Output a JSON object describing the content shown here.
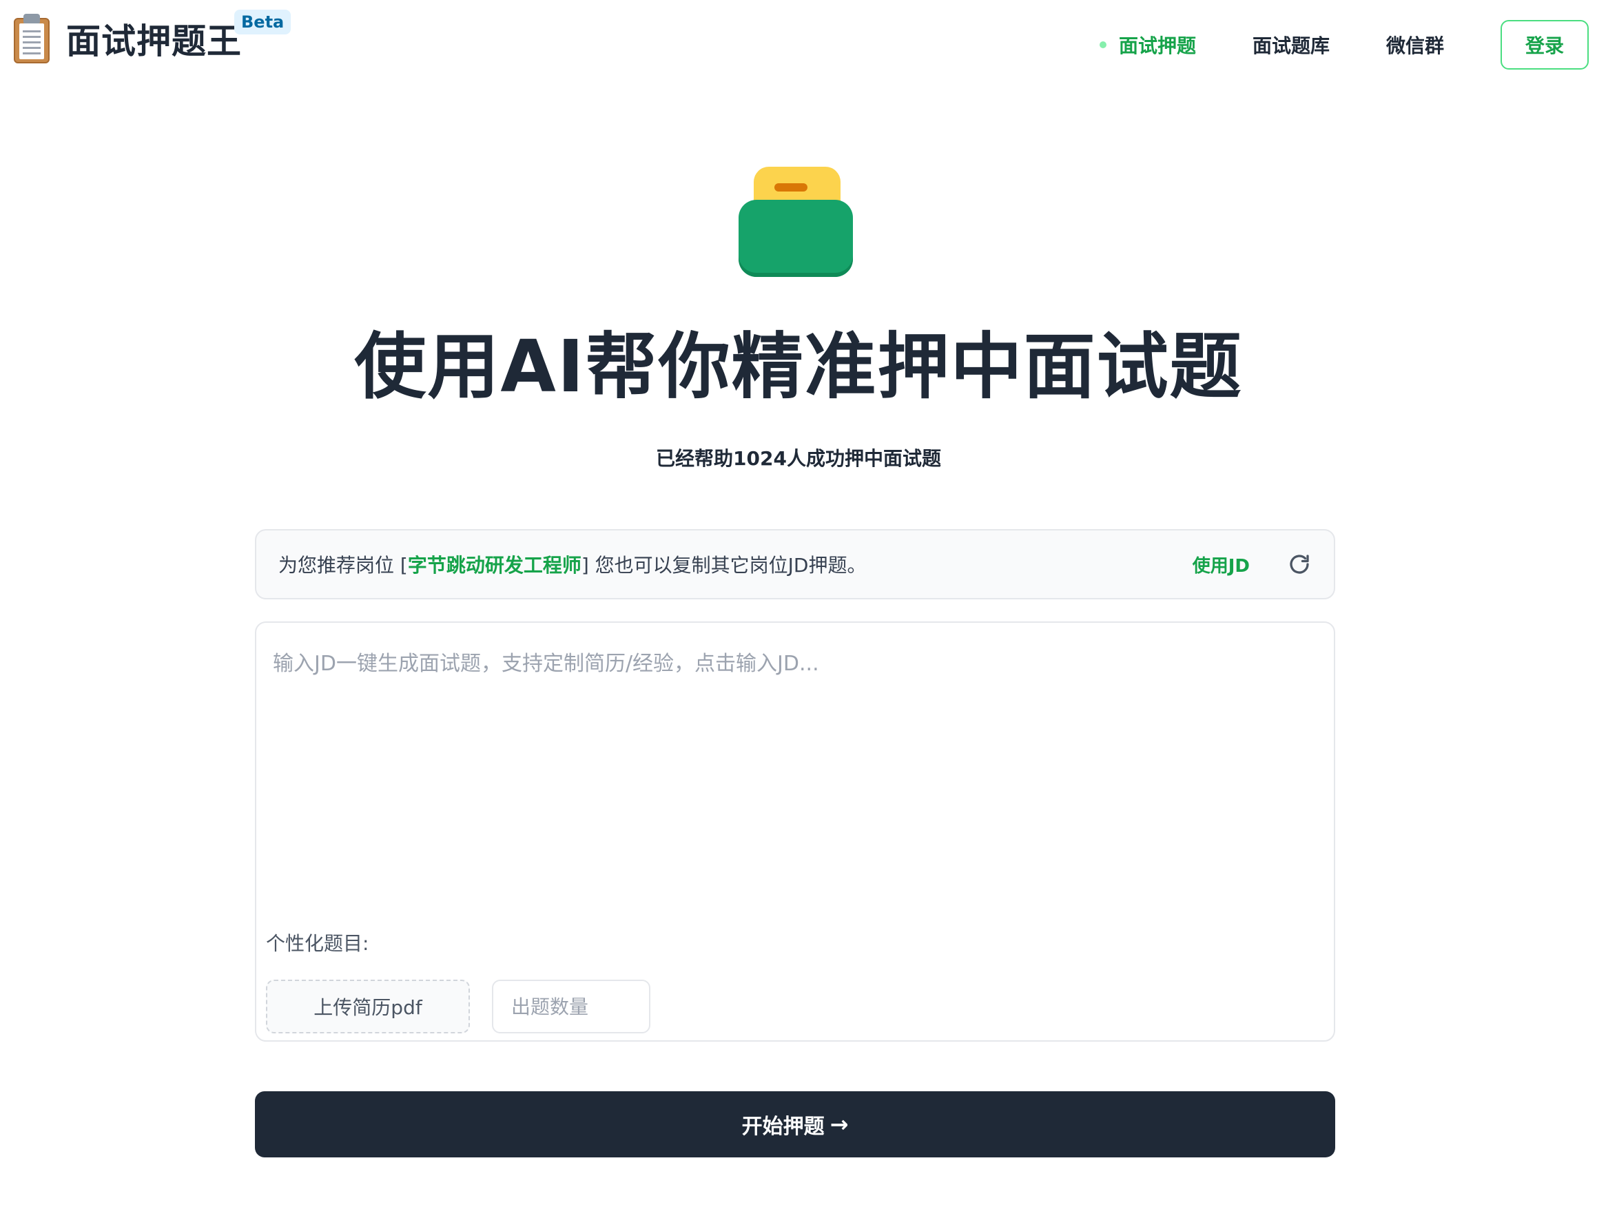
{
  "header": {
    "logo_text": "面试押题王",
    "badge": "Beta",
    "nav": {
      "items": [
        {
          "label": "面试押题",
          "active": true
        },
        {
          "label": "面试题库",
          "active": false
        },
        {
          "label": "微信群",
          "active": false
        }
      ],
      "login_label": "登录"
    }
  },
  "hero": {
    "title": "使用AI帮你精准押中面试题",
    "subtitle": "已经帮助1024人成功押中面试题"
  },
  "recommend": {
    "prefix": "为您推荐岗位 [",
    "job": "字节跳动研发工程师",
    "suffix": "] 您也可以复制其它岗位JD押题。",
    "use_jd_label": "使用JD",
    "refresh_icon": "refresh-icon"
  },
  "form": {
    "jd_placeholder": "输入JD一键生成面试题，支持定制简历/经验，点击输入JD...",
    "jd_value": "",
    "personal_label": "个性化题目:",
    "upload_label": "上传简历pdf",
    "count_placeholder": "出题数量",
    "count_value": ""
  },
  "actions": {
    "start_label": "开始押题",
    "start_arrow": "→"
  },
  "colors": {
    "accent": "#16a34a",
    "dark": "#1f2937",
    "badge_bg": "#e0f2fe",
    "badge_text": "#0369a1"
  }
}
